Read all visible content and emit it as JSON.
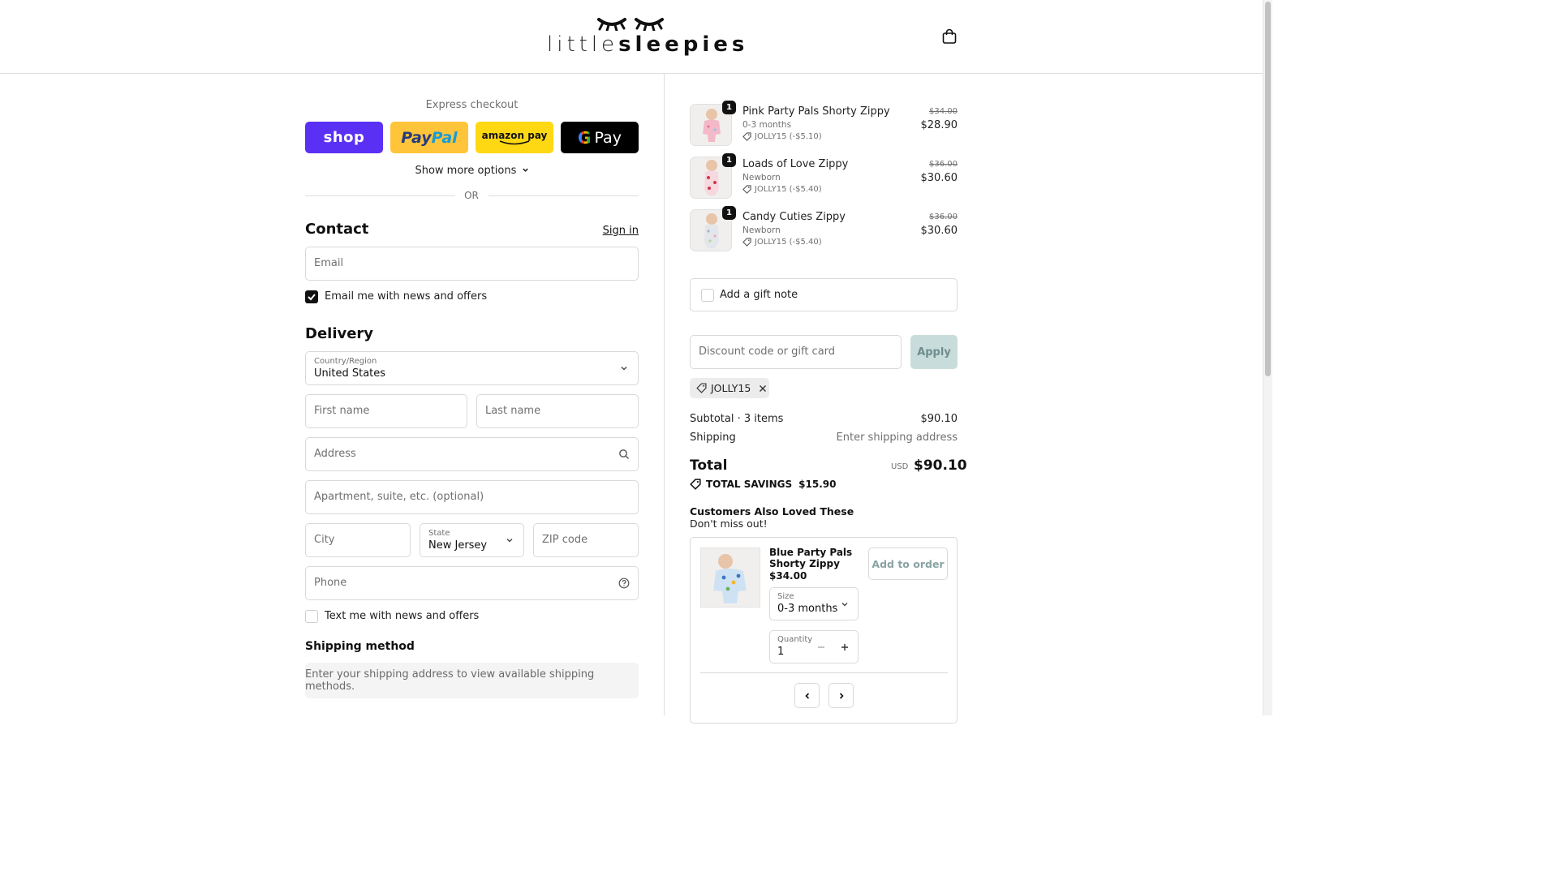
{
  "brand": {
    "logo_light": "little",
    "logo_bold": "sleepies"
  },
  "express": {
    "title": "Express checkout",
    "shop_label": "shop",
    "paypal_label_1": "Pay",
    "paypal_label_2": "Pal",
    "amazon_label": "amazon pay",
    "gpay_g": "G",
    "gpay_label": "Pay",
    "more_options": "Show more options",
    "or": "OR"
  },
  "contact": {
    "title": "Contact",
    "sign_in": "Sign in",
    "email_placeholder": "Email",
    "email_opt_in": "Email me with news and offers",
    "email_opt_in_checked": true
  },
  "delivery": {
    "title": "Delivery",
    "country_label": "Country/Region",
    "country_value": "United States",
    "first_name_placeholder": "First name",
    "last_name_placeholder": "Last name",
    "address_placeholder": "Address",
    "apartment_placeholder": "Apartment, suite, etc. (optional)",
    "city_placeholder": "City",
    "state_label": "State",
    "state_value": "New Jersey",
    "zip_placeholder": "ZIP code",
    "phone_placeholder": "Phone",
    "text_opt_in": "Text me with news and offers",
    "text_opt_in_checked": false
  },
  "shipping_method": {
    "title": "Shipping method",
    "note": "Enter your shipping address to view available shipping methods."
  },
  "cart": {
    "items": [
      {
        "qty": "1",
        "name": "Pink Party Pals Shorty Zippy",
        "variant": "0-3 months",
        "discount": "JOLLY15 (-$5.10)",
        "original": "$34.00",
        "price": "$28.90"
      },
      {
        "qty": "1",
        "name": "Loads of Love Zippy",
        "variant": "Newborn",
        "discount": "JOLLY15 (-$5.40)",
        "original": "$36.00",
        "price": "$30.60"
      },
      {
        "qty": "1",
        "name": "Candy Cuties Zippy",
        "variant": "Newborn",
        "discount": "JOLLY15 (-$5.40)",
        "original": "$36.00",
        "price": "$30.60"
      }
    ],
    "gift_note": "Add a gift note",
    "discount_placeholder": "Discount code or gift card",
    "apply": "Apply",
    "applied_code": "JOLLY15",
    "subtotal_label": "Subtotal · 3 items",
    "subtotal_value": "$90.10",
    "shipping_label": "Shipping",
    "shipping_value": "Enter shipping address",
    "total_label": "Total",
    "total_currency": "USD",
    "total_value": "$90.10",
    "savings_label": "TOTAL SAVINGS",
    "savings_value": "$15.90"
  },
  "upsell": {
    "title": "Customers Also Loved These",
    "subtitle": "Don't miss out!",
    "product_name": "Blue Party Pals Shorty Zippy",
    "product_price": "$34.00",
    "add_button": "Add to order",
    "size_label": "Size",
    "size_value": "0-3 months",
    "quantity_label": "Quantity",
    "quantity_value": "1"
  },
  "colors": {
    "shop": "#5a31f4",
    "paypal": "#ffc439",
    "amazon": "#ffd814",
    "apply_bg": "#c9dcdc"
  }
}
